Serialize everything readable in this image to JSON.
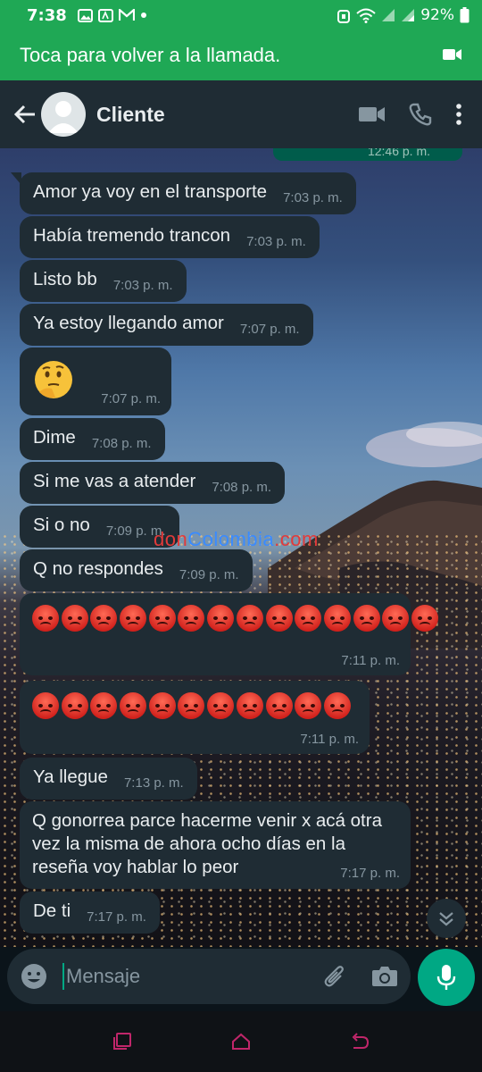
{
  "status_bar": {
    "time": "7:38",
    "battery": "92%"
  },
  "call_banner": {
    "text": "Toca para volver a la llamada."
  },
  "app_bar": {
    "contact_name": "Cliente"
  },
  "previous_outgoing": {
    "time": "12:46 p. m."
  },
  "messages": [
    {
      "text": "Amor ya voy en el transporte",
      "time": "7:03 p. m."
    },
    {
      "text": "Había tremendo trancon",
      "time": "7:03 p. m."
    },
    {
      "text": "Listo bb",
      "time": "7:03 p. m."
    },
    {
      "text": "Ya estoy llegando amor",
      "time": "7:07 p. m."
    },
    {
      "emoji": "thinking-face",
      "time": "7:07 p. m."
    },
    {
      "text": "Dime",
      "time": "7:08 p. m."
    },
    {
      "text": "Si me vas a atender",
      "time": "7:08 p. m."
    },
    {
      "text": "Si o no",
      "time": "7:09 p. m."
    },
    {
      "text": "Q no respondes",
      "time": "7:09 p. m."
    },
    {
      "emoji": "pouting-face",
      "count": 14,
      "time": "7:11 p. m."
    },
    {
      "emoji": "pouting-face",
      "count": 11,
      "time": "7:11 p. m."
    },
    {
      "text": "Ya llegue",
      "time": "7:13 p. m."
    },
    {
      "text": "Q gonorrea parce hacerme venir x acá otra vez la misma de ahora ocho días en la reseña voy hablar lo peor",
      "time": "7:17 p. m."
    },
    {
      "text": "De ti",
      "time": "7:17 p. m."
    }
  ],
  "watermark": {
    "part1": "don",
    "part2": "Colombia",
    "part3": ".com"
  },
  "composer": {
    "placeholder": "Mensaje"
  },
  "colors": {
    "accent": "#1fa855",
    "bubble_incoming": "#1f2c34",
    "bubble_outgoing": "#005c4b",
    "mic": "#00a884"
  }
}
